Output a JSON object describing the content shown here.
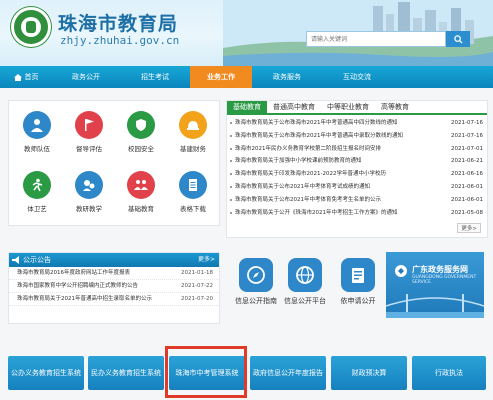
{
  "header": {
    "site_title": "珠海市教育局",
    "site_url": "zhjy.zhuhai.gov.cn",
    "search_placeholder": "请输入关键词",
    "logo_text": "ZHUHAI EDUCATION 珠海教育局"
  },
  "nav": {
    "items": [
      {
        "label": "首页",
        "active": false
      },
      {
        "label": "政务公开",
        "active": false
      },
      {
        "label": "招生考试",
        "active": false
      },
      {
        "label": "业务工作",
        "active": true
      },
      {
        "label": "政务服务",
        "active": false
      },
      {
        "label": "互动交流",
        "active": false
      }
    ]
  },
  "services": [
    {
      "label": "教师队伍",
      "icon": "teacher-icon",
      "color": "#2d87c9"
    },
    {
      "label": "督导评估",
      "icon": "flag-icon",
      "color": "#e0414a"
    },
    {
      "label": "校园安全",
      "icon": "shield-icon",
      "color": "#2a9a45"
    },
    {
      "label": "基建财务",
      "icon": "hardhat-icon",
      "color": "#f2a21b"
    },
    {
      "label": "体卫艺",
      "icon": "runner-icon",
      "color": "#2a9a45"
    },
    {
      "label": "教研教学",
      "icon": "research-icon",
      "color": "#2d87c9"
    },
    {
      "label": "基础教育",
      "icon": "people-icon",
      "color": "#e0414a"
    },
    {
      "label": "表格下载",
      "icon": "document-icon",
      "color": "#2d87c9"
    }
  ],
  "notice": {
    "title": "公示公告",
    "more": "更多>",
    "items": [
      {
        "text": "珠海市教育局2016年度政府网站工作年度报表",
        "date": "2021-01-18"
      },
      {
        "text": "珠海市国家教育中学公开招聘编内正式教师的公告",
        "date": "2021-07-22"
      },
      {
        "text": "珠海市教育局关于2021年普通高中招生录取名单的公示",
        "date": "2021-07-20"
      }
    ]
  },
  "news": {
    "tabs": [
      {
        "label": "基础教育",
        "active": true
      },
      {
        "label": "普通高中教育",
        "active": false
      },
      {
        "label": "中等职业教育",
        "active": false
      },
      {
        "label": "高等教育",
        "active": false
      }
    ],
    "items": [
      {
        "text": "珠海市教育局关于公布珠海市2021年中考普通高中四分数线的通知",
        "date": "2021-07-16"
      },
      {
        "text": "珠海市教育局关于公布珠海市2021年中考普通高中录取分数线的通知",
        "date": "2021-07-16"
      },
      {
        "text": "珠海市2021年民办义务教育学校第二阶段招生报名时间安排",
        "date": "2021-07-01"
      },
      {
        "text": "珠海市教育局关于加强中小学校课前预防教育的通知",
        "date": "2021-06-21"
      },
      {
        "text": "珠海市教育局关于印发珠海市2021-2022学年普通中小学校历",
        "date": "2021-06-16"
      },
      {
        "text": "珠海市教育局关于公布2021年中考体育考试成绩的通知",
        "date": "2021-06-01"
      },
      {
        "text": "珠海市教育局关于公布2021年中考体育免考考生名单的公示",
        "date": "2021-06-01"
      },
      {
        "text": "珠海市教育局关于公开《珠海市2021年中考招生工作方案》的通知",
        "date": "2021-05-08"
      }
    ],
    "more": "更多>"
  },
  "apps": [
    {
      "label": "信息公开指南",
      "icon": "compass-icon",
      "color": "#2d87c9"
    },
    {
      "label": "信息公开平台",
      "icon": "globe-icon",
      "color": "#2d87c9"
    },
    {
      "label": "依申请公开",
      "icon": "form-icon",
      "color": "#2d87c9"
    }
  ],
  "banner": {
    "title": "广东政务服务网",
    "subtitle": "GUANGDONG GOVERNMENT SERVICE"
  },
  "quick_links": [
    {
      "label": "公办义务教育招生系统"
    },
    {
      "label": "民办义务教育招生系统"
    },
    {
      "label": "珠海市中考管理系统",
      "highlighted": true
    },
    {
      "label": "政府信息公开年度报告"
    },
    {
      "label": "财政预决算"
    },
    {
      "label": "行政执法"
    }
  ]
}
